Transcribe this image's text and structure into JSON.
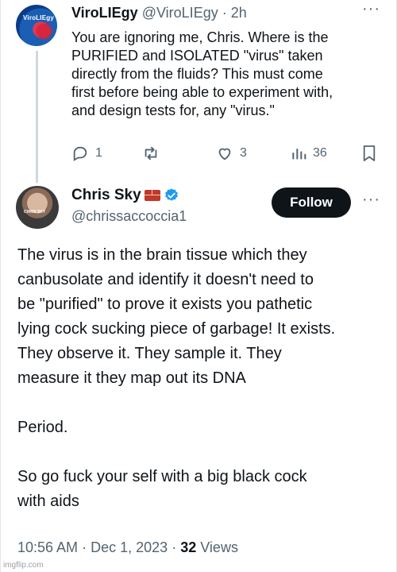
{
  "parent_tweet": {
    "display_name": "ViroLIEgy",
    "handle": "@ViroLIEgy",
    "separator": "·",
    "time_ago": "2h",
    "avatar_text": "ViroLIEgy",
    "text": "You are ignoring me, Chris. Where is the\nPURIFIED and ISOLATED \"virus\" taken\ndirectly from the fluids? This must come\nfirst before being able to experiment with,\nand design tests for, any \"virus.\"",
    "replies": "1",
    "retweets": "",
    "likes": "3",
    "views": "36",
    "icons": [
      "reply-icon",
      "retweet-icon",
      "like-icon",
      "views-icon",
      "bookmark-icon",
      "more-icon"
    ]
  },
  "main_tweet": {
    "display_name": "Chris Sky",
    "handle": "@chrissaccoccia1",
    "avatar_text": "CHRIS SKY",
    "follow_label": "Follow",
    "text": "The virus is in the brain tissue which they\ncanbusolate and identify it doesn't need to\nbe \"purified\" to prove it exists you pathetic\nlying cock sucking piece of garbage! It exists.\nThey observe it. They sample it. They\nmeasure it they map out its DNA\n\nPeriod.\n\nSo go fuck your self with a big black cock\nwith aids",
    "time": "10:56 AM",
    "date": "Dec 1, 2023",
    "separator": "·",
    "views_count": "32",
    "views_label": "Views",
    "icons": [
      "brick-icon",
      "verified-badge-icon",
      "more-icon"
    ]
  },
  "watermark": "imgflip.com",
  "colors": {
    "text": "#0f1419",
    "muted": "#536471",
    "verified": "#1d9bf0",
    "follow_bg": "#0f1419",
    "thread_line": "#cfd9de"
  }
}
